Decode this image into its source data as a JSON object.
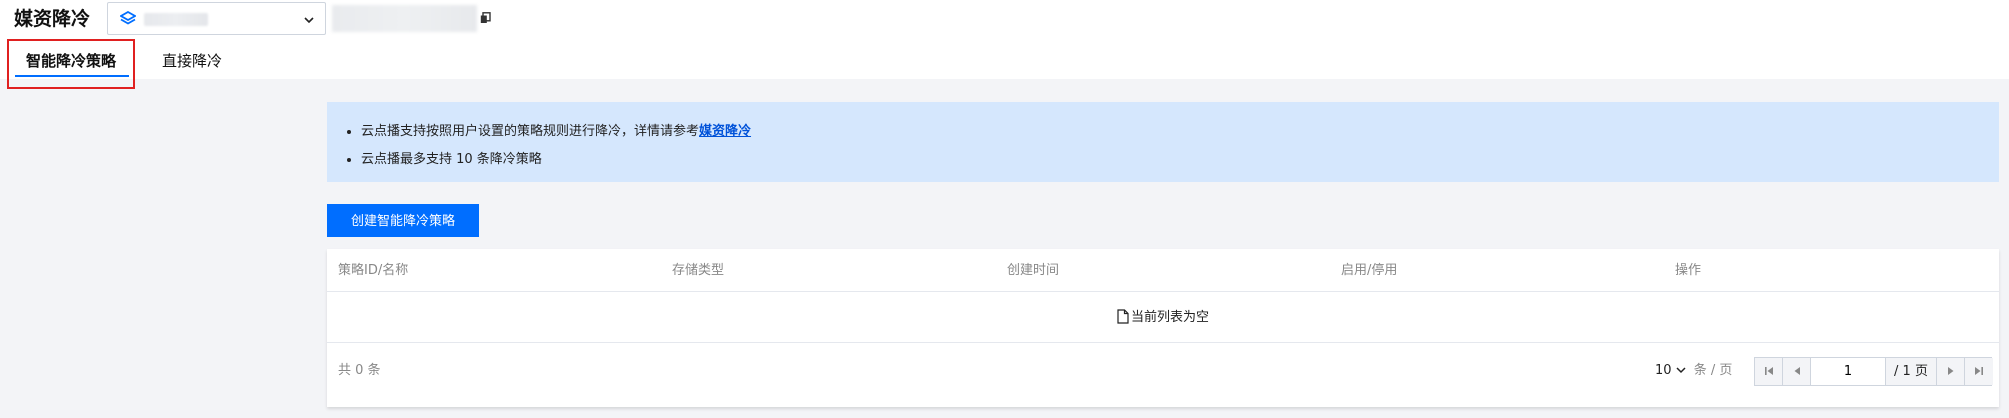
{
  "header": {
    "title": "媒资降冷",
    "app_select_value": "",
    "app_id": ""
  },
  "tabs": [
    {
      "label": "智能降冷策略",
      "active": true
    },
    {
      "label": "直接降冷",
      "active": false
    }
  ],
  "notice": {
    "line1_prefix": "云点播支持按照用户设置的策略规则进行降冷，详情请参考",
    "line1_link": "媒资降冷",
    "line2": "云点播最多支持 10 条降冷策略"
  },
  "create_button": "创建智能降冷策略",
  "table": {
    "columns": [
      "策略ID/名称",
      "存储类型",
      "创建时间",
      "启用/停用",
      "操作"
    ],
    "rows": [],
    "empty_text": "当前列表为空"
  },
  "pagination": {
    "total_text": "共 0 条",
    "page_size": "10",
    "page_size_unit": "条 / 页",
    "current_page": "1",
    "total_pages_text": "/ 1 页"
  },
  "colors": {
    "accent": "#006eff",
    "notice_bg": "#d5e7fd",
    "highlight": "#e02020"
  }
}
